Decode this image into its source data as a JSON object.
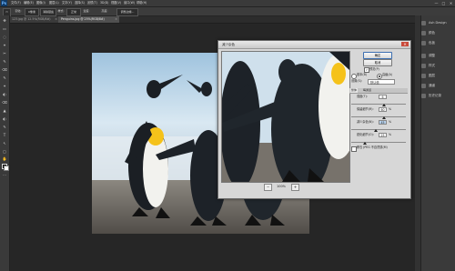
{
  "app": {
    "logo": "Ps",
    "menu": [
      "文件(F)",
      "编辑(E)",
      "图像(I)",
      "图层(L)",
      "文字(Y)",
      "选择(S)",
      "滤镜(T)",
      "3D(D)",
      "视图(V)",
      "窗口(W)",
      "帮助(H)"
    ],
    "window_controls": [
      "—",
      "□",
      "✕"
    ]
  },
  "options_bar": {
    "items": [
      "▭",
      "羽化:",
      "0像素",
      "消除锯齿",
      "样式:",
      "正常",
      "宽度:",
      "高度:",
      "调整边缘..."
    ]
  },
  "tabs": [
    {
      "label": "123.jpg @ 12.5%(RGB/8#)",
      "active": false
    },
    {
      "label": "Penguins.jpg @ 25%(RGB/8#)",
      "active": true
    }
  ],
  "tools": [
    "▭",
    "✥",
    "◌",
    "⌖",
    "✂",
    "✎",
    "⌫",
    "◐",
    "✦",
    "▲",
    "T",
    "↖",
    "▢",
    "✋",
    "🔍",
    "…"
  ],
  "panels": [
    {
      "label": "Ash Design",
      "icon": "swatch-icon"
    },
    {
      "label": "颜色",
      "icon": "color-icon"
    },
    {
      "label": "色板",
      "icon": "swatches-icon"
    },
    {
      "label": "调整",
      "icon": "adjustments-icon"
    },
    {
      "label": "样式",
      "icon": "styles-icon"
    },
    {
      "label": "图层",
      "icon": "layers-icon"
    },
    {
      "label": "通道",
      "icon": "channels-icon"
    },
    {
      "label": "路径",
      "icon": "paths-icon"
    },
    {
      "label": "历史记录",
      "icon": "history-icon"
    }
  ],
  "dialog": {
    "title": "减少杂色",
    "close": "✕",
    "zoom": {
      "minus": "−",
      "value": "100%",
      "plus": "+"
    },
    "ok": "确定",
    "cancel": "取消",
    "preview_label": "预览(P)",
    "preview_checked": true,
    "mode_basic": "基本(B)",
    "mode_advanced": "高级(A)",
    "mode_selected": "advanced",
    "settings_label": "设置(S):",
    "settings_value": "默认值",
    "sub_tabs": [
      "整体",
      "每通道"
    ],
    "rows": [
      {
        "label": "强度(T):",
        "value": "6",
        "unit": ""
      },
      {
        "label": "保留细节(R):",
        "value": "60",
        "unit": "%"
      },
      {
        "label": "减少杂色(N):",
        "value": "45",
        "unit": "%"
      },
      {
        "label": "锐化细节(O):",
        "value": "25",
        "unit": "%"
      }
    ],
    "slider_levels": [
      0.6,
      0.6,
      0.45,
      0.25
    ],
    "jpeg_label": "移去 JPEG 不自然感(M)"
  },
  "colors": {
    "accent": "#3d6fb0",
    "sky": "#b8d3e8",
    "ground": "#6f6a62"
  }
}
